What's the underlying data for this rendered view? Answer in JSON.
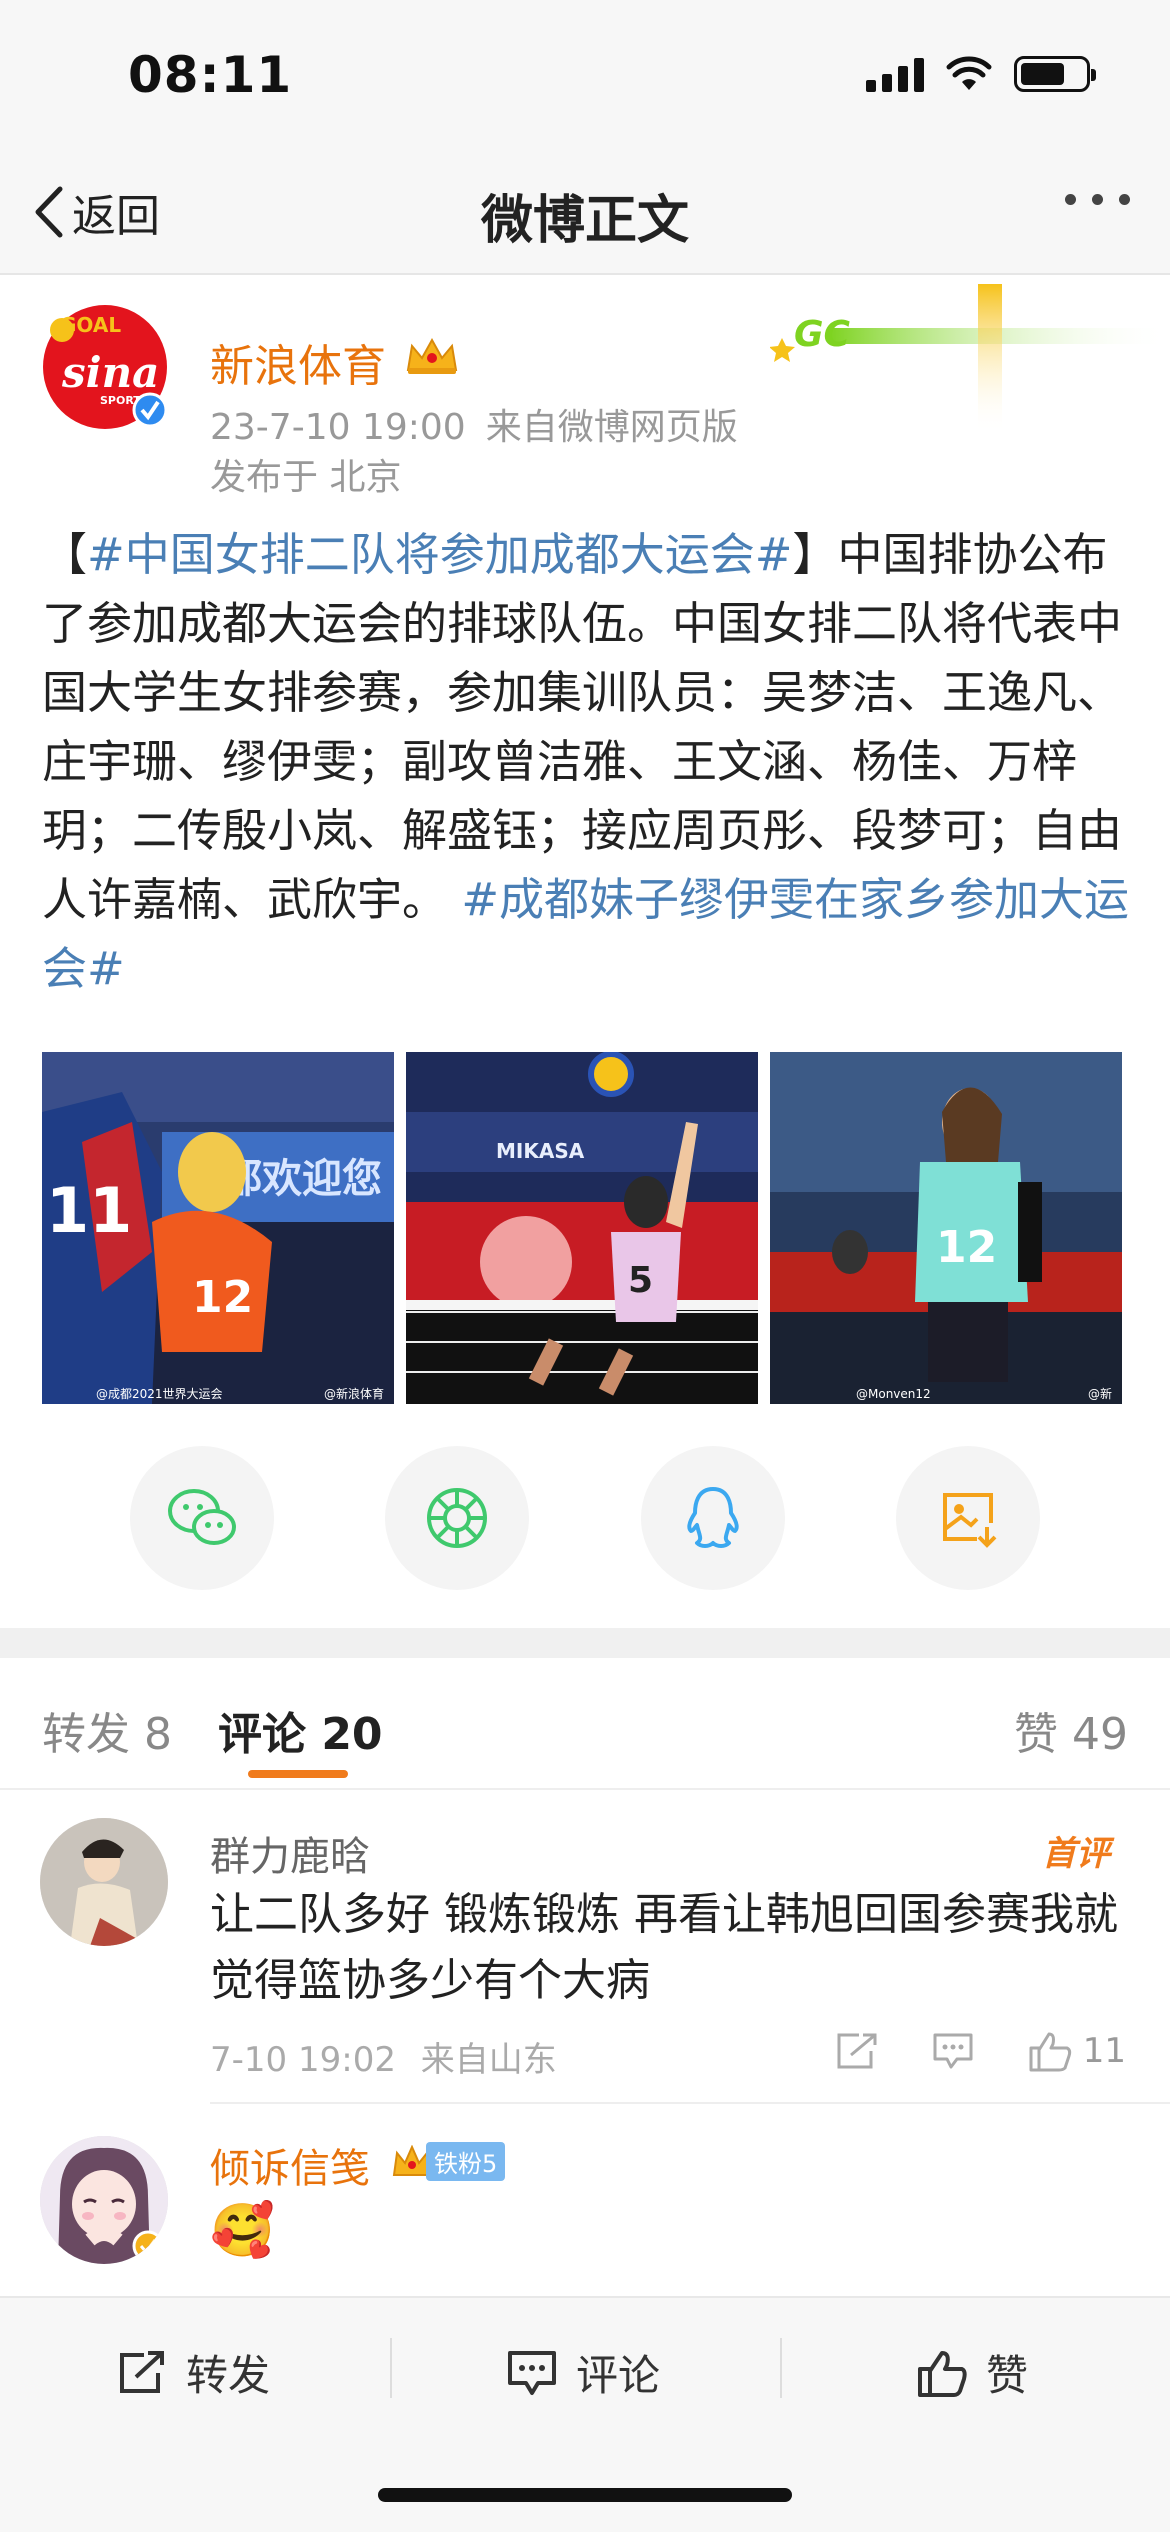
{
  "status_bar": {
    "time": "08:11"
  },
  "nav": {
    "back_label": "返回",
    "title": "微博正文"
  },
  "post": {
    "author": "新浪体育",
    "timestamp": "23-7-10 19:00",
    "source": "来自微博网页版",
    "location": "发布于 北京",
    "text_parts": [
      {
        "text": "【",
        "hashtag": false
      },
      {
        "text": "#中国女排二队将参加成都大运会#",
        "hashtag": true
      },
      {
        "text": "】中国排协公布了参加成都大运会的排球队伍。中国女排二队将代表中国大学生女排参赛，参加集训队员：吴梦洁、王逸凡、庄宇珊、缪伊雯；副攻曾洁雅、王文涵、杨佳、万梓玥；二传殷小岚、解盛钰；接应周页彤、段梦可；自由人许嘉楠、武欣宇。 ",
        "hashtag": false
      },
      {
        "text": "#成都妹子缪伊雯在家乡参加大运会#",
        "hashtag": true
      }
    ],
    "photos": [
      {
        "watermark_left": "@成都2021世界大运会",
        "watermark_right": "@新浪体育",
        "jersey": "11",
        "jersey2": "12",
        "banner": "郫都欢迎您"
      },
      {
        "watermark_left": "",
        "watermark_right": "",
        "jersey": "5",
        "brand": "MIKASA"
      },
      {
        "watermark_left": "@Monven12",
        "watermark_right": "@新",
        "jersey": "12"
      }
    ]
  },
  "share_icons": [
    "wechat-icon",
    "moments-icon",
    "qq-icon",
    "save-image-icon"
  ],
  "tabs": {
    "repost": "转发 8",
    "comment": "评论 20",
    "like": "赞 49"
  },
  "comments": [
    {
      "user": "群力鹿晗",
      "badge": "首评",
      "text": "让二队多好 锻炼锻炼 再看让韩旭回国参赛我就觉得篮协多少有个大病",
      "time": "7-10 19:02",
      "source": "来自山东",
      "likes": "11"
    },
    {
      "user": "倾诉信笺",
      "fan_badge": "铁粉5",
      "emoji": "🥰"
    }
  ],
  "bottom_bar": {
    "repost": "转发",
    "comment": "评论",
    "like": "赞"
  },
  "colors": {
    "accent": "#f07b1c",
    "hashtag": "#4a7fb5",
    "username": "#e8730c"
  }
}
